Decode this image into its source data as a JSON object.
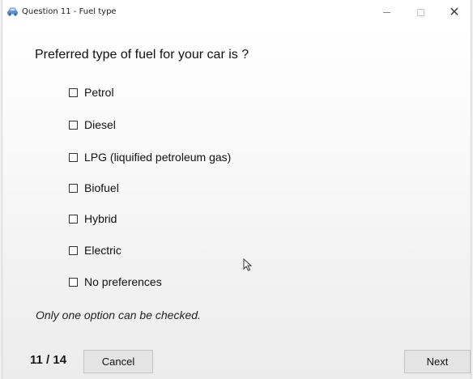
{
  "window": {
    "title": "Question 11 - Fuel type",
    "icon": "car-icon",
    "controls": {
      "minimize": "minimize-icon",
      "maximize": "maximize-icon",
      "close": "✕"
    }
  },
  "question": "Preferred type of fuel for your car is ?",
  "options": [
    {
      "label": "Petrol",
      "checked": false
    },
    {
      "label": "Diesel",
      "checked": false
    },
    {
      "label": "LPG (liquified petroleum gas)",
      "checked": false
    },
    {
      "label": "Biofuel",
      "checked": false
    },
    {
      "label": "Hybrid",
      "checked": false
    },
    {
      "label": "Electric",
      "checked": false
    },
    {
      "label": "No preferences",
      "checked": false
    }
  ],
  "hint": "Only one option can be checked.",
  "footer": {
    "counter": "11 / 14",
    "cancel_label": "Cancel",
    "next_label": "Next"
  },
  "colors": {
    "icon_blue": "#5b8fd6",
    "button_bg": "#e4e4e4",
    "text": "#111111"
  }
}
